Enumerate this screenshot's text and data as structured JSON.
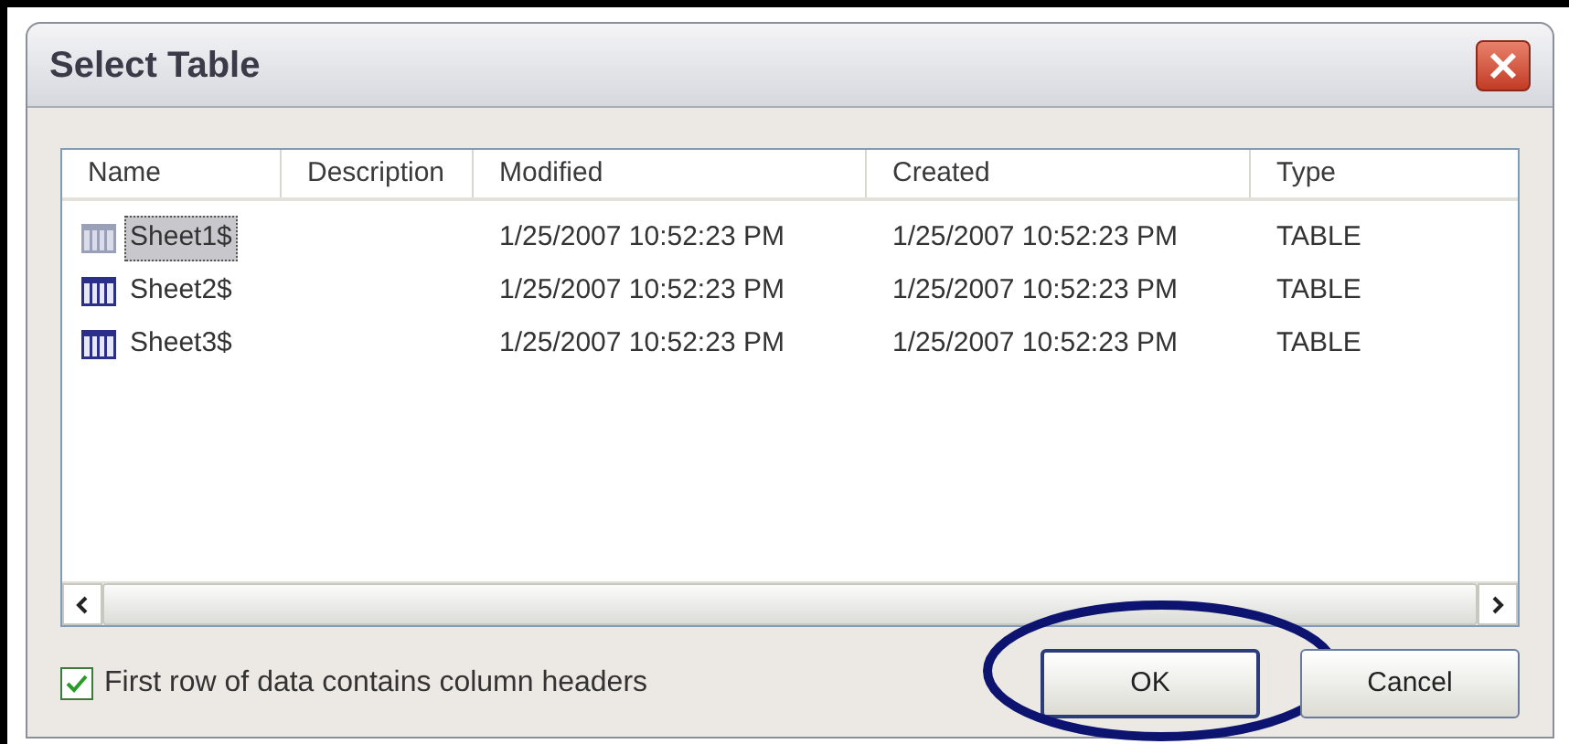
{
  "window": {
    "title": "Select Table"
  },
  "table": {
    "columns": [
      "Name",
      "Description",
      "Modified",
      "Created",
      "Type"
    ],
    "rows": [
      {
        "name": "Sheet1$",
        "description": "",
        "modified": "1/25/2007 10:52:23 PM",
        "created": "1/25/2007 10:52:23 PM",
        "type": "TABLE",
        "selected": true
      },
      {
        "name": "Sheet2$",
        "description": "",
        "modified": "1/25/2007 10:52:23 PM",
        "created": "1/25/2007 10:52:23 PM",
        "type": "TABLE",
        "selected": false
      },
      {
        "name": "Sheet3$",
        "description": "",
        "modified": "1/25/2007 10:52:23 PM",
        "created": "1/25/2007 10:52:23 PM",
        "type": "TABLE",
        "selected": false
      }
    ]
  },
  "header_option": {
    "label": "First row of data contains column headers",
    "checked": true
  },
  "buttons": [
    {
      "label": "OK",
      "highlighted": true
    },
    {
      "label": "Cancel",
      "highlighted": false
    }
  ]
}
